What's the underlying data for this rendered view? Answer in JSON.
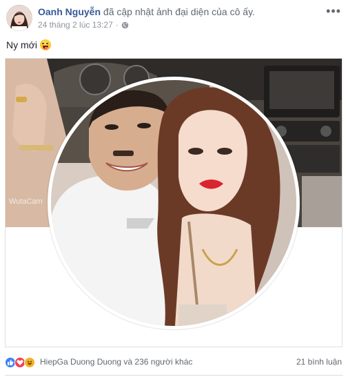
{
  "post": {
    "author": "Oanh Nguyễn",
    "action": "đã cập nhật ảnh đại diện của cô ấy.",
    "timestamp": "24 tháng 2 lúc 13:27",
    "privacy_icon": "globe-icon",
    "more_label": "•••",
    "caption": "Ny mới",
    "caption_emoji": "tongue-out-wink-emoji"
  },
  "footer": {
    "reaction_icons": [
      "like-icon",
      "love-icon",
      "haha-icon"
    ],
    "reaction_text": "HiepGa Duong Duong và 236 người khác",
    "comments_text": "21 bình luận"
  },
  "colors": {
    "author_link": "#385898",
    "meta_gray": "#90949c",
    "like_blue": "#3b82f6",
    "love_red": "#f33e58",
    "haha_yellow": "#f7b125"
  }
}
